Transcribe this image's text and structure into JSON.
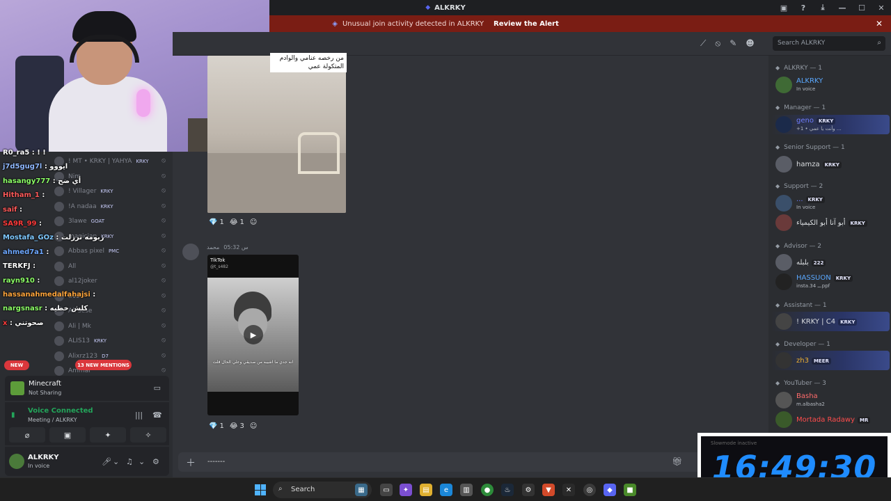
{
  "titlebar": {
    "title": "ALKRKY"
  },
  "alert": {
    "text": "Unusual join activity detected in ALKRKY",
    "link": "Review the Alert"
  },
  "header": {
    "search_placeholder": "Search ALKRKY"
  },
  "voice_members": [
    {
      "name": "! MT • KRKY | YAHYA",
      "badge": "KRKY"
    },
    {
      "name": "Nim",
      "badge": ""
    },
    {
      "name": "! Villager",
      "badge": "KRKY"
    },
    {
      "name": "!A nadaa",
      "badge": "KRKY"
    },
    {
      "name": "3lawe",
      "badge": "GOAT"
    },
    {
      "name": "magician",
      "badge": "KRKY"
    },
    {
      "name": "Abbas pixel",
      "badge": "PMC"
    },
    {
      "name": "All",
      "badge": ""
    },
    {
      "name": "al12joker",
      "badge": ""
    },
    {
      "name": "a123",
      "badge": ""
    },
    {
      "name": "All sese",
      "badge": ""
    },
    {
      "name": "Ali | Mk",
      "badge": ""
    },
    {
      "name": "ALIS13",
      "badge": "KRKY"
    },
    {
      "name": "Alixrz123",
      "badge": "D7"
    },
    {
      "name": "Ammar",
      "badge": ""
    }
  ],
  "chat": [
    {
      "user": "R0_ra5",
      "msg": ": ! !",
      "color": "#ffffff"
    },
    {
      "user": "j7d5gug7l",
      "msg": ": ايووو",
      "color": "#8fb8ff"
    },
    {
      "user": "hasangy777",
      "msg": ": أي ضح",
      "color": "#8cff66"
    },
    {
      "user": "Hitham_1",
      "msg": ":",
      "color": "#ff5a5a"
    },
    {
      "user": "saif",
      "msg": ":",
      "color": "#ff5a5a"
    },
    {
      "user": "SA9R_99",
      "msg": ":",
      "color": "#ff3b3b"
    },
    {
      "user": "Mostafa_GOz",
      "msg": ": زبومه ترزلت",
      "color": "#7ec8ff"
    },
    {
      "user": "ahmed7a1",
      "msg": ":",
      "color": "#6ea8ff"
    },
    {
      "user": "TERKFJ",
      "msg": ":",
      "color": "#ffffff"
    },
    {
      "user": "rayn910",
      "msg": ":",
      "color": "#8cff66"
    },
    {
      "user": "hassanahmedalfahajsi",
      "msg": ":",
      "color": "#ffa53b"
    },
    {
      "user": "nargsnasr",
      "msg": ": كلش خطيه",
      "color": "#8cff66"
    },
    {
      "user": "x",
      "msg": ": صحوتني",
      "color": "#ff3b3b"
    }
  ],
  "pills": {
    "new": "NEW",
    "mentions": "13 NEW MENTIONS"
  },
  "activity": {
    "title": "Minecraft",
    "sub": "Not Sharing"
  },
  "voice": {
    "title": "Voice Connected",
    "sub": "Meeting / ALKRKY"
  },
  "user": {
    "name": "ALKRKY",
    "status": "In voice"
  },
  "message": {
    "image_caption": "من رخصه عنامي والوادم المتكولة عمي",
    "reactions1": [
      {
        "emoji": "💎",
        "count": "1"
      },
      {
        "emoji": "😂",
        "count": "1"
      }
    ],
    "author": "محمد",
    "time": "س 05:32",
    "tiktok_label": "TikTok",
    "tiktok_user": "@t_s482",
    "tiktok_subtitle": "انه جدي ما اشيبه من صديقي وعلي الحال قلت",
    "reactions2": [
      {
        "emoji": "💎",
        "count": "1"
      },
      {
        "emoji": "😂",
        "count": "3"
      }
    ]
  },
  "composer": {
    "text": "-------"
  },
  "roles": [
    {
      "label": "ALKRKY — 1"
    },
    {
      "label": "Manager — 1"
    },
    {
      "label": "Senior Support — 1"
    },
    {
      "label": "Support — 2"
    },
    {
      "label": "Advisor — 2"
    },
    {
      "label": "Assistant — 1"
    },
    {
      "label": "Developer — 1"
    },
    {
      "label": "YouTuber — 3"
    }
  ],
  "members": [
    {
      "name": "ALKRKY",
      "sub": "In voice",
      "badge": "",
      "color": "#5aa8ff"
    },
    {
      "name": "geno",
      "sub": "+1 • وأنت يا عمي ...",
      "badge": "KRKY",
      "color": "#6f7dff"
    },
    {
      "name": "hamza",
      "sub": "",
      "badge": "KRKY",
      "color": "#dbdee1"
    },
    {
      "name": "...",
      "sub": "In voice",
      "badge": "KRKY",
      "color": "#6f7dff"
    },
    {
      "name": "أبو آنا أبو الكيمياء",
      "sub": "",
      "badge": "KRKY",
      "color": "#dbdee1"
    },
    {
      "name": "بلبله",
      "sub": "",
      "badge": "222",
      "color": "#dbdee1"
    },
    {
      "name": "HASSUON",
      "sub": "insta.ــ 34.ppf",
      "badge": "KRKY",
      "color": "#5aa8ff"
    },
    {
      "name": "! KRKY | C4",
      "sub": "",
      "badge": "KRKY",
      "color": "#dbdee1"
    },
    {
      "name": "zh3",
      "sub": "",
      "badge": "MEER",
      "color": "#f0b232"
    },
    {
      "name": "Basha",
      "sub": "m.albasha2",
      "badge": "",
      "color": "#ff6b6b"
    },
    {
      "name": "Mortada Radawy",
      "sub": "",
      "badge": "MR",
      "color": "#ff4d4d"
    }
  ],
  "clock": {
    "time": "16:49:30",
    "top": "Slowmode inactive"
  },
  "taskbar": {
    "search": "Search"
  }
}
